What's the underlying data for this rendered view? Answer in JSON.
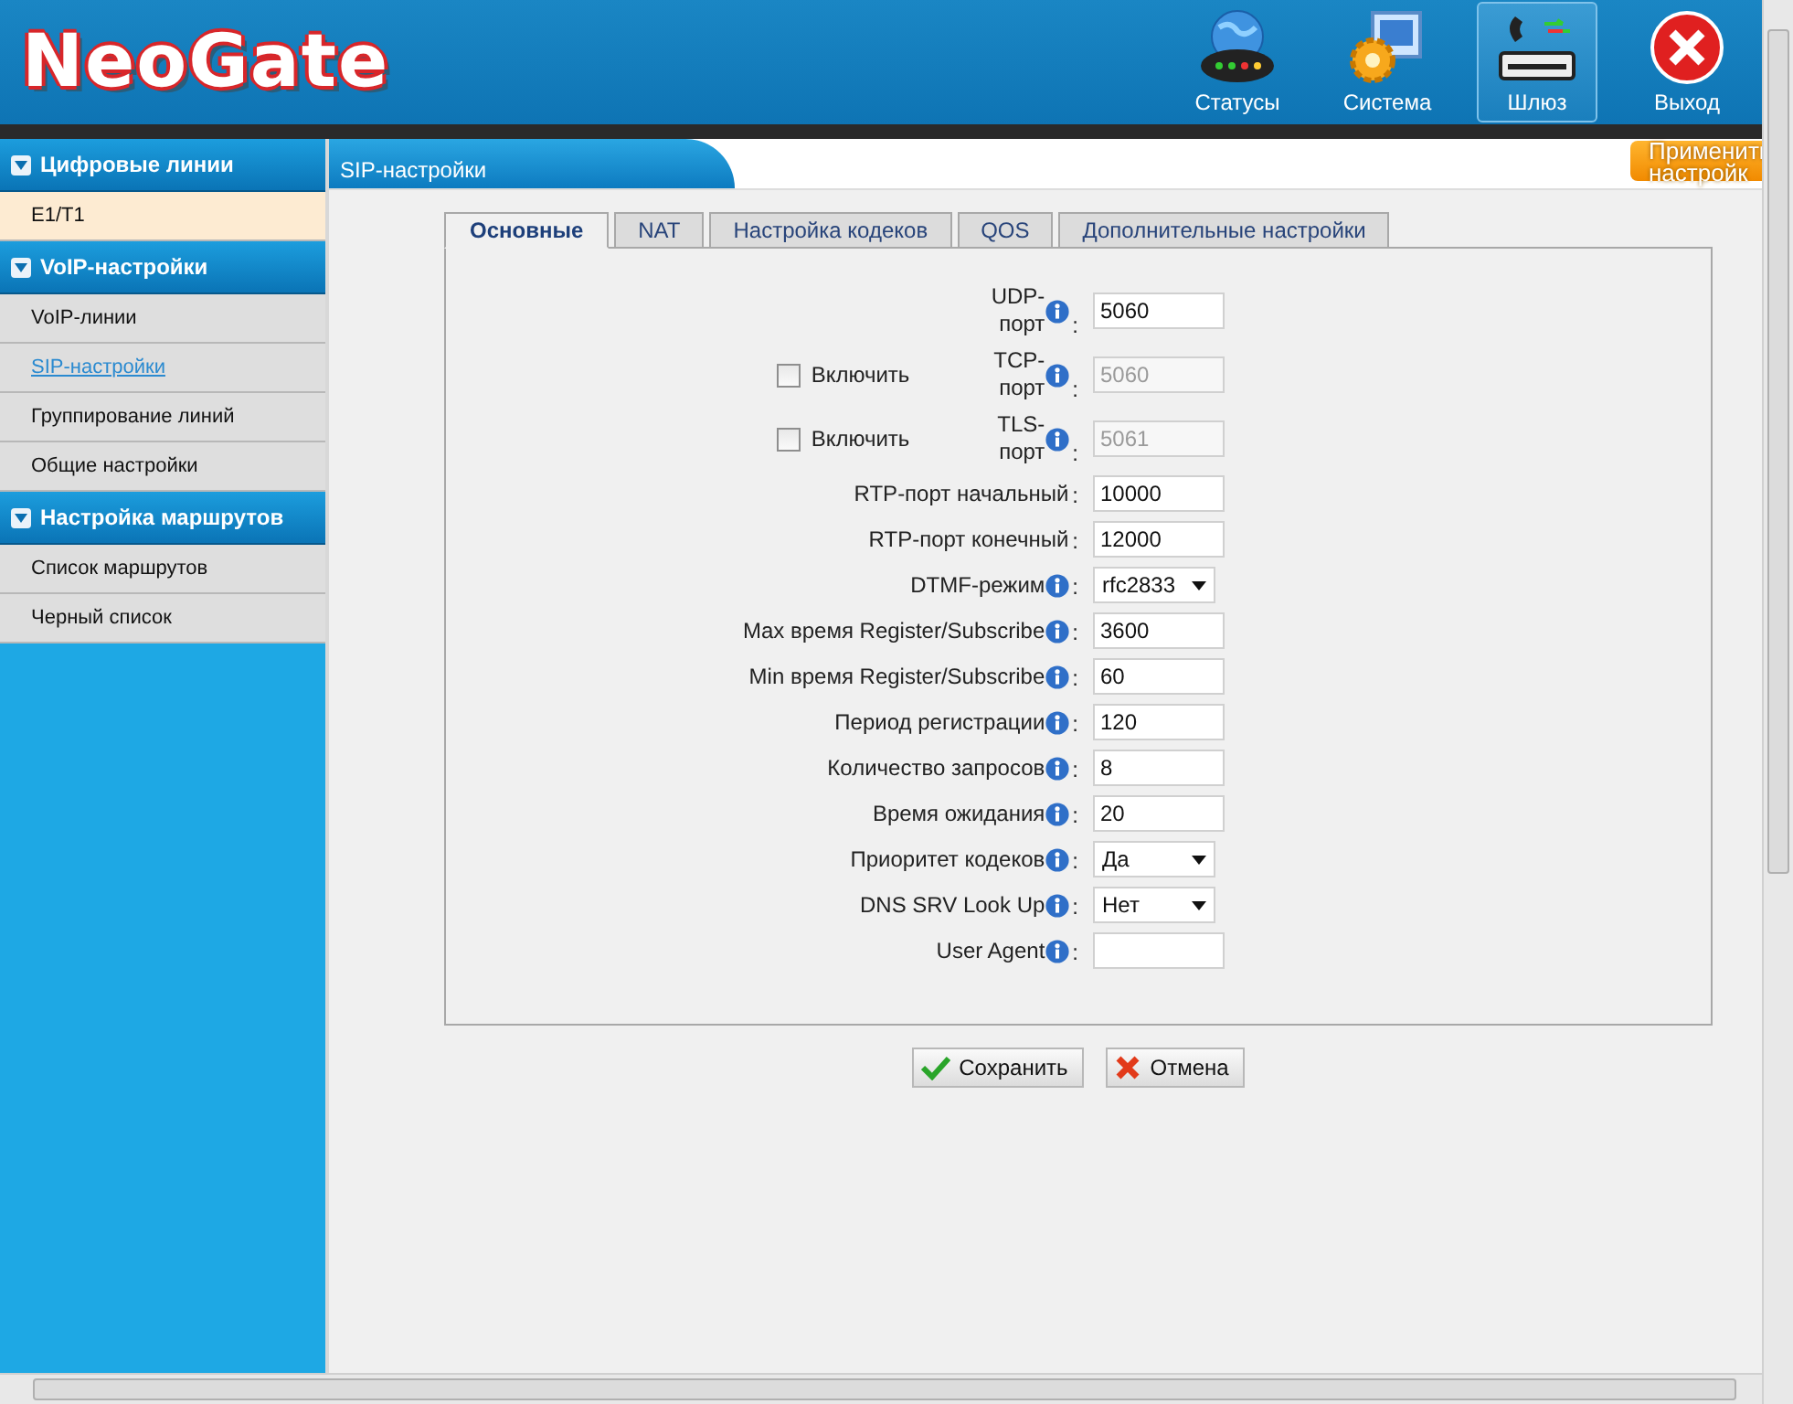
{
  "header": {
    "logo": "NeoGate",
    "nav": [
      {
        "label": "Статусы",
        "selected": false
      },
      {
        "label": "Система",
        "selected": false
      },
      {
        "label": "Шлюз",
        "selected": true
      },
      {
        "label": "Выход",
        "selected": false
      }
    ]
  },
  "sidebar": {
    "sections": [
      {
        "title": "Цифровые линии",
        "items": [
          {
            "label": "E1/T1",
            "selected": false,
            "highlighted": true
          }
        ]
      },
      {
        "title": "VoIP-настройки",
        "items": [
          {
            "label": "VoIP-линии",
            "selected": false,
            "highlighted": false
          },
          {
            "label": "SIP-настройки",
            "selected": true,
            "highlighted": false
          },
          {
            "label": "Группирование линий",
            "selected": false,
            "highlighted": false
          },
          {
            "label": "Общие настройки",
            "selected": false,
            "highlighted": false
          }
        ]
      },
      {
        "title": "Настройка маршрутов",
        "items": [
          {
            "label": "Список маршрутов",
            "selected": false,
            "highlighted": false
          },
          {
            "label": "Черный список",
            "selected": false,
            "highlighted": false
          }
        ]
      }
    ]
  },
  "page_title": "SIP-настройки",
  "apply_button": [
    "Применить",
    "настройк"
  ],
  "tabs": [
    {
      "label": "Основные",
      "selected": true
    },
    {
      "label": "NAT",
      "selected": false
    },
    {
      "label": "Настройка кодеков",
      "selected": false
    },
    {
      "label": "QOS",
      "selected": false
    },
    {
      "label": "Дополнительные настройки",
      "selected": false
    }
  ],
  "fields": [
    {
      "kind": "port",
      "label": "UDP-порт",
      "info": true,
      "value": "5060",
      "disabled": false
    },
    {
      "kind": "port",
      "label": "TCP-порт",
      "info": true,
      "value": "5060",
      "disabled": true,
      "enable": {
        "label": "Включить",
        "checked": false
      }
    },
    {
      "kind": "port",
      "label": "TLS-порт",
      "info": true,
      "value": "5061",
      "disabled": true,
      "enable": {
        "label": "Включить",
        "checked": false
      }
    },
    {
      "kind": "text",
      "label": "RTP-порт начальный",
      "info": false,
      "value": "10000"
    },
    {
      "kind": "text",
      "label": "RTP-порт конечный",
      "info": false,
      "value": "12000"
    },
    {
      "kind": "select",
      "label": "DTMF-режим",
      "info": true,
      "value": "rfc2833"
    },
    {
      "kind": "text",
      "label": "Max время Register/Subscribe",
      "info": true,
      "value": "3600"
    },
    {
      "kind": "text",
      "label": "Min время Register/Subscribe",
      "info": true,
      "value": "60"
    },
    {
      "kind": "text",
      "label": "Период регистрации",
      "info": true,
      "value": "120"
    },
    {
      "kind": "text",
      "label": "Количество запросов",
      "info": true,
      "value": "8"
    },
    {
      "kind": "text",
      "label": "Время ожидания",
      "info": true,
      "value": "20"
    },
    {
      "kind": "select",
      "label": "Приоритет кодеков",
      "info": true,
      "value": "Да"
    },
    {
      "kind": "select",
      "label": "DNS SRV Look Up",
      "info": true,
      "value": "Нет"
    },
    {
      "kind": "text",
      "label": "User Agent",
      "info": true
    }
  ],
  "buttons": [
    {
      "label": "Сохранить",
      "kind": "save"
    },
    {
      "label": "Отмена",
      "kind": "cancel"
    }
  ],
  "colon": ":"
}
